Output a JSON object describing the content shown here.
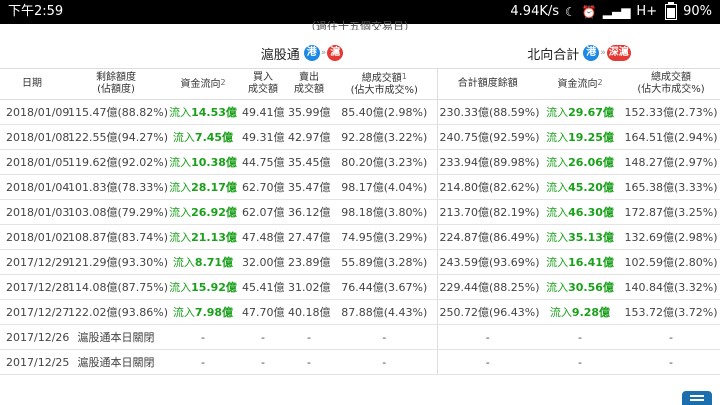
{
  "status_bar": {
    "time": "下午2:59",
    "speed": "4.94K/s",
    "network": "H+",
    "battery": "90%"
  },
  "subtitle": "（過往十五個交易日）",
  "left_section": {
    "title": "滬股通",
    "tag_from": "港",
    "tag_to": "滬"
  },
  "right_section": {
    "title": "北向合計",
    "tag_from": "港",
    "tag_to": "深滬"
  },
  "headers": {
    "date": "日期",
    "remaining_quota": "剩餘額度",
    "remaining_quota_sub": "(佔額度)",
    "capital_flow": "資金流向",
    "capital_flow_sup": "2",
    "buy": "買入",
    "buy_sub": "成交額",
    "sell": "賣出",
    "sell_sub": "成交額",
    "total_turnover": "總成交額",
    "total_turnover_sup": "1",
    "total_turnover_sub": "(佔大市成交%)",
    "combined_remaining": "合計額度餘額",
    "north_capital_flow": "資金流向",
    "north_capital_flow_sup": "2",
    "north_total_turnover": "總成交額",
    "north_total_turnover_sub": "(佔大市成交%)"
  },
  "rows": [
    {
      "date": "2018/01/09",
      "quota": "115.47億(88.82%)",
      "flow_prefix": "流入",
      "flow": "14.53億",
      "buy": "49.41億",
      "sell": "35.99億",
      "turnover": "85.40億(2.98%)",
      "n_quota": "230.33億(88.59%)",
      "n_flow_prefix": "流入",
      "n_flow": "29.67億",
      "n_turnover": "152.33億(2.73%)"
    },
    {
      "date": "2018/01/08",
      "quota": "122.55億(94.27%)",
      "flow_prefix": "流入",
      "flow": "7.45億",
      "buy": "49.31億",
      "sell": "42.97億",
      "turnover": "92.28億(3.22%)",
      "n_quota": "240.75億(92.59%)",
      "n_flow_prefix": "流入",
      "n_flow": "19.25億",
      "n_turnover": "164.51億(2.94%)"
    },
    {
      "date": "2018/01/05",
      "quota": "119.62億(92.02%)",
      "flow_prefix": "流入",
      "flow": "10.38億",
      "buy": "44.75億",
      "sell": "35.45億",
      "turnover": "80.20億(3.23%)",
      "n_quota": "233.94億(89.98%)",
      "n_flow_prefix": "流入",
      "n_flow": "26.06億",
      "n_turnover": "148.27億(2.97%)"
    },
    {
      "date": "2018/01/04",
      "quota": "101.83億(78.33%)",
      "flow_prefix": "流入",
      "flow": "28.17億",
      "buy": "62.70億",
      "sell": "35.47億",
      "turnover": "98.17億(4.04%)",
      "n_quota": "214.80億(82.62%)",
      "n_flow_prefix": "流入",
      "n_flow": "45.20億",
      "n_turnover": "165.38億(3.33%)"
    },
    {
      "date": "2018/01/03",
      "quota": "103.08億(79.29%)",
      "flow_prefix": "流入",
      "flow": "26.92億",
      "buy": "62.07億",
      "sell": "36.12億",
      "turnover": "98.18億(3.80%)",
      "n_quota": "213.70億(82.19%)",
      "n_flow_prefix": "流入",
      "n_flow": "46.30億",
      "n_turnover": "172.87億(3.25%)"
    },
    {
      "date": "2018/01/02",
      "quota": "108.87億(83.74%)",
      "flow_prefix": "流入",
      "flow": "21.13億",
      "buy": "47.48億",
      "sell": "27.47億",
      "turnover": "74.95億(3.29%)",
      "n_quota": "224.87億(86.49%)",
      "n_flow_prefix": "流入",
      "n_flow": "35.13億",
      "n_turnover": "132.69億(2.98%)"
    },
    {
      "date": "2017/12/29",
      "quota": "121.29億(93.30%)",
      "flow_prefix": "流入",
      "flow": "8.71億",
      "buy": "32.00億",
      "sell": "23.89億",
      "turnover": "55.89億(3.28%)",
      "n_quota": "243.59億(93.69%)",
      "n_flow_prefix": "流入",
      "n_flow": "16.41億",
      "n_turnover": "102.59億(2.80%)"
    },
    {
      "date": "2017/12/28",
      "quota": "114.08億(87.75%)",
      "flow_prefix": "流入",
      "flow": "15.92億",
      "buy": "45.41億",
      "sell": "31.02億",
      "turnover": "76.44億(3.67%)",
      "n_quota": "229.44億(88.25%)",
      "n_flow_prefix": "流入",
      "n_flow": "30.56億",
      "n_turnover": "140.84億(3.32%)"
    },
    {
      "date": "2017/12/27",
      "quota": "122.02億(93.86%)",
      "flow_prefix": "流入",
      "flow": "7.98億",
      "buy": "47.70億",
      "sell": "40.18億",
      "turnover": "87.88億(4.43%)",
      "n_quota": "250.72億(96.43%)",
      "n_flow_prefix": "流入",
      "n_flow": "9.28億",
      "n_turnover": "153.72億(3.72%)"
    },
    {
      "date": "2017/12/26",
      "quota": "滬股通本日關閉",
      "flow_prefix": "",
      "flow": "-",
      "buy": "-",
      "sell": "-",
      "turnover": "-",
      "n_quota": "-",
      "n_flow_prefix": "",
      "n_flow": "-",
      "n_turnover": "-"
    },
    {
      "date": "2017/12/25",
      "quota": "滬股通本日關閉",
      "flow_prefix": "",
      "flow": "-",
      "buy": "-",
      "sell": "-",
      "turnover": "-",
      "n_quota": "-",
      "n_flow_prefix": "",
      "n_flow": "-",
      "n_turnover": "-"
    }
  ]
}
